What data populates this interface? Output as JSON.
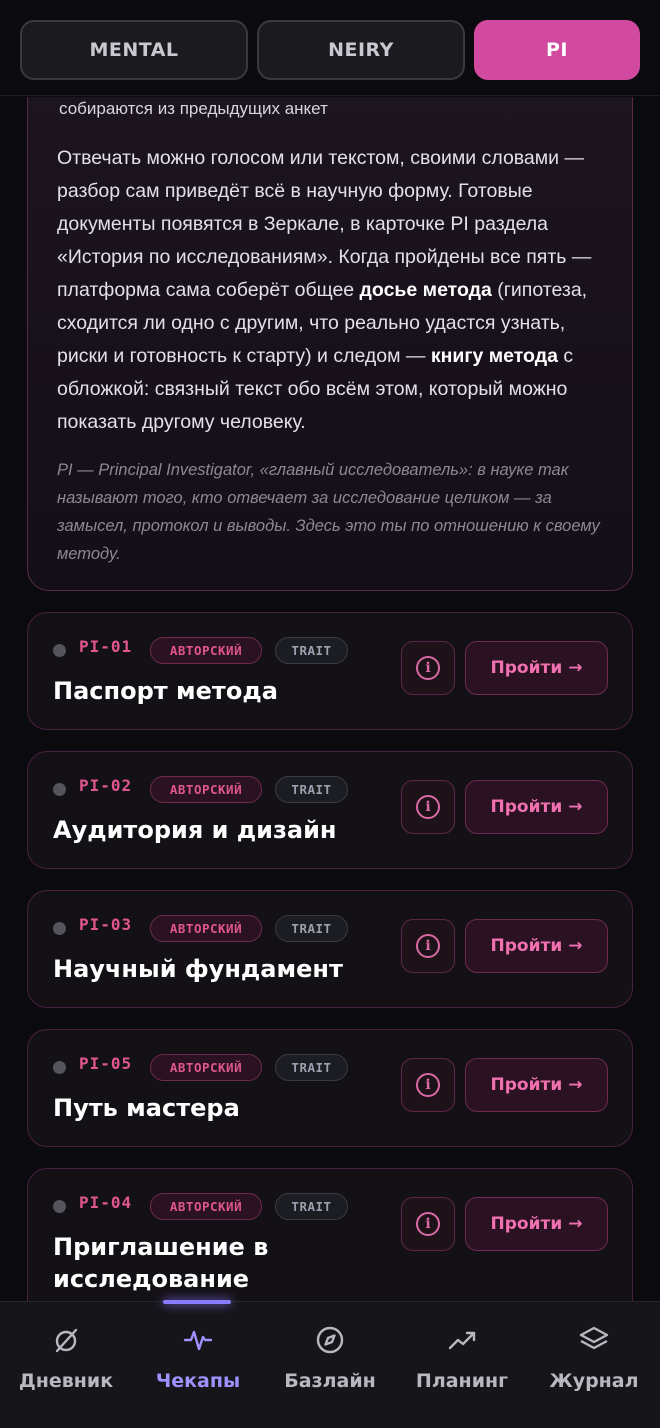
{
  "tabs": [
    {
      "label": "MENTAL",
      "active": false
    },
    {
      "label": "NEIRY",
      "active": false
    },
    {
      "label": "PI",
      "active": true
    }
  ],
  "info": {
    "bullet_tail": "собираются из предыдущих анкет",
    "p1_a": "Отвечать можно голосом или текстом, своими словами — разбор сам приведёт всё в научную форму. Готовые документы появятся в Зеркале, в карточке PI раздела «История по исследованиям». Когда пройдены все пять — платформа сама соберёт общее ",
    "p1_b": "досье метода",
    "p1_c": " (гипотеза, сходится ли одно с другим, что реально удастся узнать, риски и готовность к старту) и следом — ",
    "p1_d": "книгу метода",
    "p1_e": " с обложкой: связный текст обо всём этом, который можно показать другому человеку.",
    "note": "PI — Principal Investigator, «главный исследователь»: в науке так называют того, кто отвечает за исследование целиком — за замысел, протокол и выводы. Здесь это ты по отношению к своему методу."
  },
  "checkups": [
    {
      "code": "PI-01",
      "badge_author": "АВТОРСКИЙ",
      "badge_trait": "TRAIT",
      "title": "Паспорт метода",
      "action": "Пройти →"
    },
    {
      "code": "PI-02",
      "badge_author": "АВТОРСКИЙ",
      "badge_trait": "TRAIT",
      "title": "Аудитория и дизайн",
      "action": "Пройти →"
    },
    {
      "code": "PI-03",
      "badge_author": "АВТОРСКИЙ",
      "badge_trait": "TRAIT",
      "title": "Научный фундамент",
      "action": "Пройти →"
    },
    {
      "code": "PI-05",
      "badge_author": "АВТОРСКИЙ",
      "badge_trait": "TRAIT",
      "title": "Путь мастера",
      "action": "Пройти →"
    },
    {
      "code": "PI-04",
      "badge_author": "АВТОРСКИЙ",
      "badge_trait": "TRAIT",
      "title": "Приглашение в исследование",
      "action": "Пройти →"
    }
  ],
  "info_icon_glyph": "i",
  "nav": [
    {
      "label": "Дневник",
      "icon": "diary-icon",
      "active": false
    },
    {
      "label": "Чекапы",
      "icon": "pulse-icon",
      "active": true
    },
    {
      "label": "Базлайн",
      "icon": "compass-icon",
      "active": false
    },
    {
      "label": "Планинг",
      "icon": "trend-icon",
      "active": false
    },
    {
      "label": "Журнал",
      "icon": "layers-icon",
      "active": false
    }
  ],
  "colors": {
    "accent_pink": "#d14aa0",
    "accent_violet": "#9f92ff",
    "background": "#0b0a0f"
  }
}
